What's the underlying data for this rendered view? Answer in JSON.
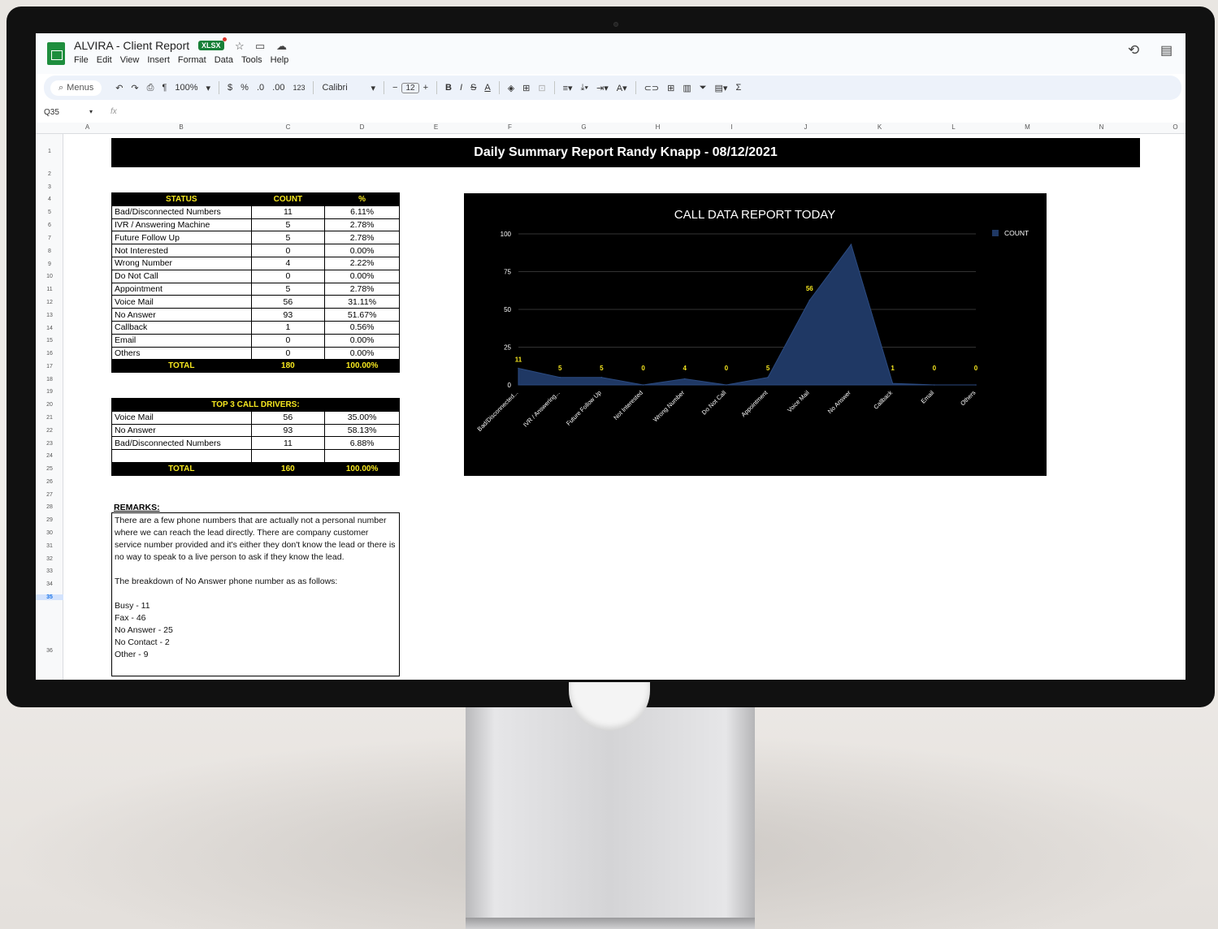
{
  "app": {
    "doc_title": "ALVIRA - Client Report",
    "file_badge": "XLSX",
    "menus": [
      "File",
      "Edit",
      "View",
      "Insert",
      "Format",
      "Data",
      "Tools",
      "Help"
    ]
  },
  "toolbar": {
    "search_label": "Menus",
    "zoom": "100%",
    "currency": "$",
    "percent": "%",
    "dec_decrease": ".0",
    "dec_increase": ".00",
    "number_format": "123",
    "font": "Calibri",
    "font_size": "12",
    "bold": "B",
    "italic": "I",
    "strike": "S",
    "text_color": "A",
    "sum": "Σ"
  },
  "formula_bar": {
    "cell_ref": "Q35",
    "fx": "fx"
  },
  "columns": [
    "A",
    "B",
    "C",
    "D",
    "E",
    "F",
    "G",
    "H",
    "I",
    "J",
    "K",
    "L",
    "M",
    "N",
    "O"
  ],
  "rows": [
    "1",
    "2",
    "3",
    "4",
    "5",
    "6",
    "7",
    "8",
    "9",
    "10",
    "11",
    "12",
    "13",
    "14",
    "15",
    "16",
    "17",
    "18",
    "19",
    "20",
    "21",
    "22",
    "23",
    "24",
    "25",
    "26",
    "27",
    "28",
    "29",
    "30",
    "31",
    "32",
    "33",
    "34",
    "35",
    "36"
  ],
  "report": {
    "banner": "Daily Summary Report  Randy Knapp - 08/12/2021",
    "status_table": {
      "headers": [
        "STATUS",
        "COUNT",
        "%"
      ],
      "rows": [
        [
          "Bad/Disconnected Numbers",
          "11",
          "6.11%"
        ],
        [
          "IVR / Answering Machine",
          "5",
          "2.78%"
        ],
        [
          "Future Follow Up",
          "5",
          "2.78%"
        ],
        [
          "Not Interested",
          "0",
          "0.00%"
        ],
        [
          "Wrong Number",
          "4",
          "2.22%"
        ],
        [
          "Do Not Call",
          "0",
          "0.00%"
        ],
        [
          "Appointment",
          "5",
          "2.78%"
        ],
        [
          "Voice Mail",
          "56",
          "31.11%"
        ],
        [
          "No Answer",
          "93",
          "51.67%"
        ],
        [
          "Callback",
          "1",
          "0.56%"
        ],
        [
          "Email",
          "0",
          "0.00%"
        ],
        [
          "Others",
          "0",
          "0.00%"
        ]
      ],
      "total": [
        "TOTAL",
        "180",
        "100.00%"
      ]
    },
    "drivers_table": {
      "header": "TOP 3 CALL DRIVERS:",
      "rows": [
        [
          "Voice Mail",
          "56",
          "35.00%"
        ],
        [
          "No Answer",
          "93",
          "58.13%"
        ],
        [
          "Bad/Disconnected Numbers",
          "11",
          "6.88%"
        ],
        [
          "",
          "",
          ""
        ]
      ],
      "total": [
        "TOTAL",
        "160",
        "100.00%"
      ]
    },
    "remarks": {
      "title": "REMARKS:",
      "paragraph1": "There are a few phone numbers that are actually not a personal number where we can reach the lead directly. There are company customer service number provided and it's  either they don't know the lead or there is no way to speak  to a live person to ask  if they know the lead.",
      "paragraph2": "The breakdown of No Answer  phone number as as follows:",
      "lines": [
        "Busy - 11",
        "Fax - 46",
        "No Answer - 25",
        "No Contact - 2",
        "Other - 9"
      ]
    }
  },
  "chart_data": {
    "type": "area",
    "title": "CALL DATA REPORT TODAY",
    "categories": [
      "Bad/Disconnected...",
      "IVR / Answering...",
      "Future Follow Up",
      "Not Interested",
      "Wrong Number",
      "Do Not Call",
      "Appointment",
      "Voice Mail",
      "No Answer",
      "Callback",
      "Email",
      "Others"
    ],
    "series": [
      {
        "name": "COUNT",
        "values": [
          11,
          5,
          5,
          0,
          4,
          0,
          5,
          56,
          93,
          1,
          0,
          0
        ]
      }
    ],
    "data_labels": [
      "11",
      "5",
      "5",
      "0",
      "4",
      "0",
      "5",
      "56",
      "",
      "1",
      "0",
      "0"
    ],
    "yticks": [
      "0",
      "25",
      "50",
      "75",
      "100"
    ],
    "ylim": [
      0,
      100
    ],
    "legend": "top-right",
    "grid": true,
    "colors": {
      "background": "#000000",
      "fill": "#1f3864",
      "label": "#f6e71f",
      "text": "#ffffff"
    }
  }
}
